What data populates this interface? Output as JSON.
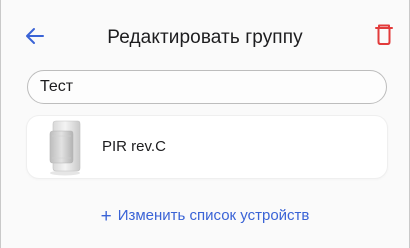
{
  "header": {
    "title": "Редактировать группу"
  },
  "form": {
    "group_name_value": "Тест"
  },
  "devices": [
    {
      "name": "PIR rev.C"
    }
  ],
  "actions": {
    "edit_devices_icon": "+",
    "edit_devices_label": "Изменить список устройств"
  },
  "colors": {
    "accent": "#3a63d6",
    "danger": "#e23b3b",
    "text": "#1d1d1f"
  },
  "icons": {
    "back": "arrow-left-icon",
    "delete": "trash-icon",
    "device": "motion-sensor-icon"
  }
}
